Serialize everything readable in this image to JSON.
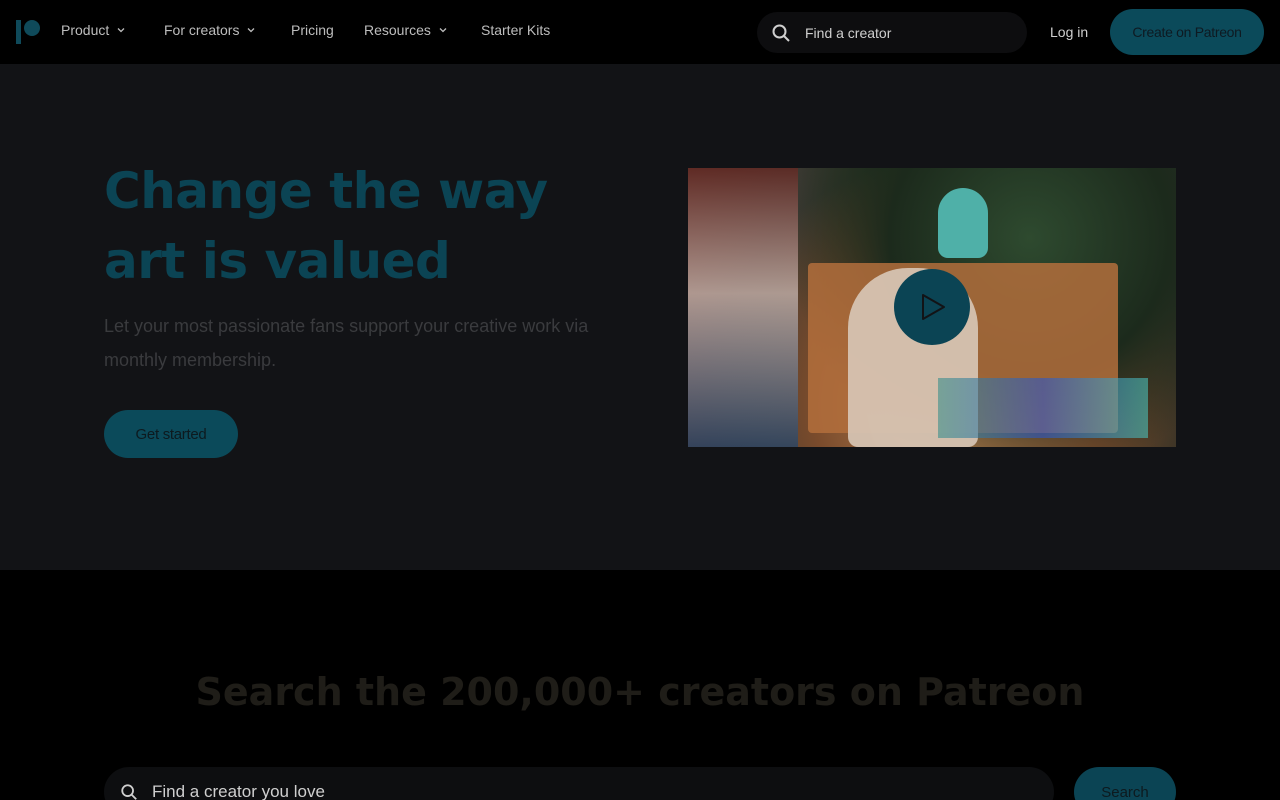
{
  "nav": {
    "items": [
      {
        "label": "Product",
        "has_dropdown": true
      },
      {
        "label": "For creators",
        "has_dropdown": true
      },
      {
        "label": "Pricing",
        "has_dropdown": false
      },
      {
        "label": "Resources",
        "has_dropdown": true
      },
      {
        "label": "Starter Kits",
        "has_dropdown": false
      }
    ],
    "search_placeholder": "Find a creator",
    "login_label": "Log in",
    "create_label": "Create on Patreon"
  },
  "hero": {
    "title_line1": "Change the way",
    "title_line2": "art is valued",
    "subtitle": "Let your most passionate fans support your creative work via monthly membership.",
    "cta_label": "Get started",
    "video_icon": "play-icon"
  },
  "search_section": {
    "title": "Search the 200,000+ creators on Patreon",
    "placeholder": "Find a creator you love",
    "button_label": "Search"
  },
  "colors": {
    "brand": "#0b4a5a",
    "hero_bg": "#121316",
    "page_bg": "#000000"
  }
}
